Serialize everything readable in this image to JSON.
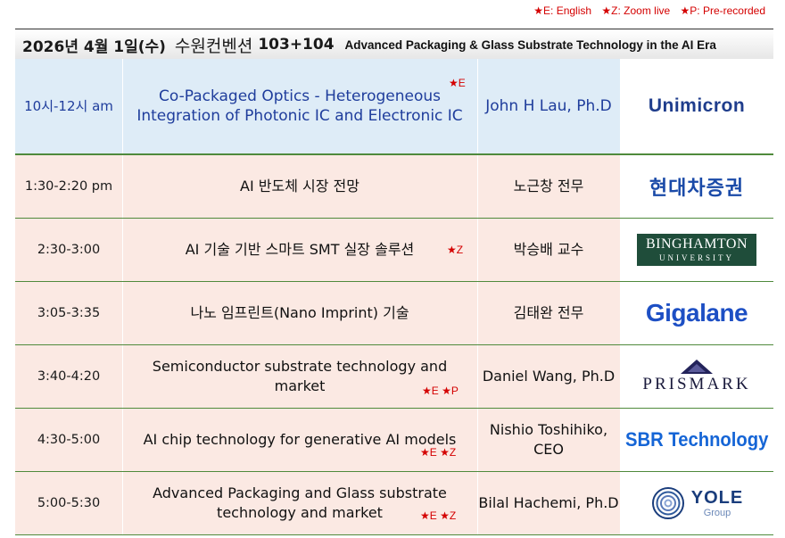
{
  "legend": {
    "english": "★E: English",
    "zoom": "★Z: Zoom live",
    "prerecorded": "★P: Pre-recorded"
  },
  "header": {
    "date": "2026년 4월 1일(수)",
    "venue": "수원컨벤션",
    "room": "103+104",
    "subtitle": "Advanced Packaging & Glass Substrate Technology in the AI Era"
  },
  "sessions": [
    {
      "time": "10시-12시 am",
      "title": "Co-Packaged Optics - Heterogeneous Integration of Photonic IC and Electronic IC",
      "tags": "★E",
      "speaker": "John H Lau, Ph.D",
      "logo": "Unimicron"
    },
    {
      "time": "1:30-2:20 pm",
      "title": "AI 반도체 시장 전망",
      "tags": "",
      "speaker": "노근창 전무",
      "logo": "현대차증권"
    },
    {
      "time": "2:30-3:00",
      "title": "AI 기술 기반 스마트 SMT 실장 솔루션",
      "tags": "★Z",
      "speaker": "박승배 교수",
      "logo": "BINGHAMTON",
      "logo_sub": "UNIVERSITY"
    },
    {
      "time": "3:05-3:35",
      "title": "나노 임프린트(Nano Imprint) 기술",
      "tags": "",
      "speaker": "김태완 전무",
      "logo": "Gigalane"
    },
    {
      "time": "3:40-4:20",
      "title": "Semiconductor substrate technology and market",
      "tags": "★E ★P",
      "speaker": "Daniel Wang, Ph.D",
      "logo": "PRISMARK"
    },
    {
      "time": "4:30-5:00",
      "title": "AI chip technology for generative AI models",
      "tags": "★E ★Z",
      "speaker": "Nishio Toshihiko, CEO",
      "logo": "SBR Technology"
    },
    {
      "time": "5:00-5:30",
      "title": "Advanced Packaging and Glass substrate technology and market",
      "tags": "★E ★Z",
      "speaker": "Bilal Hachemi, Ph.D",
      "logo": "YOLE",
      "logo_sub": "Group"
    }
  ],
  "colors": {
    "first_row_bg": "#deecf7",
    "row_bg": "#fbe9e3",
    "accent_blue": "#1f3d9c",
    "row_border": "#4f8a3c",
    "tag_red": "#d40000"
  }
}
